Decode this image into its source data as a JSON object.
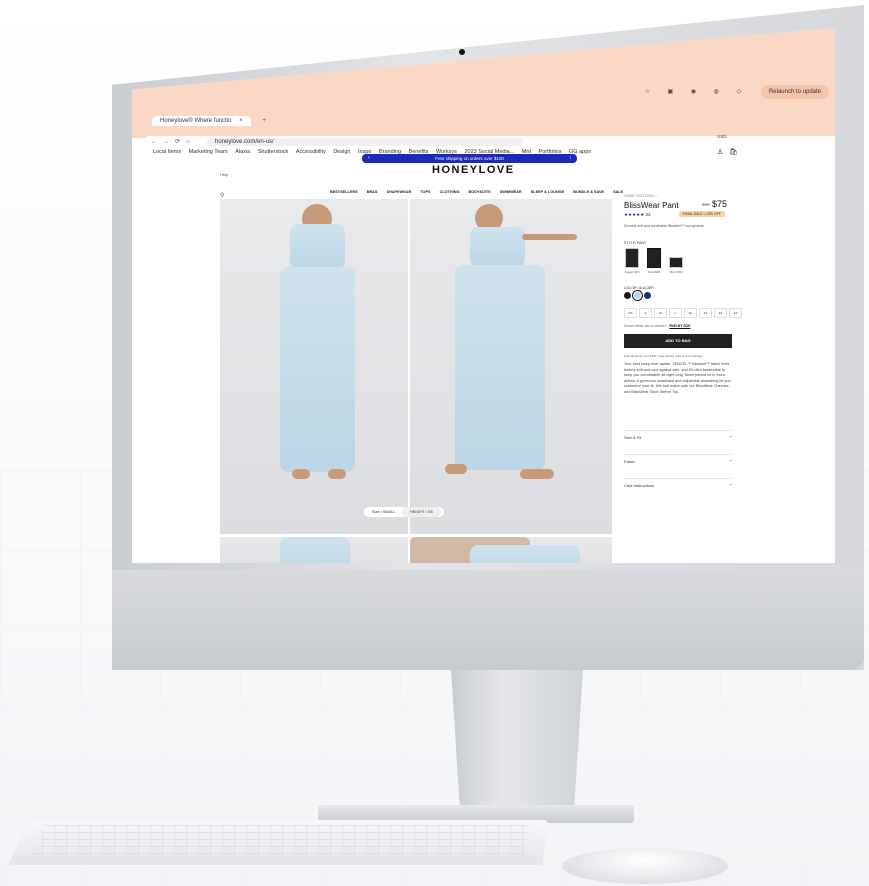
{
  "browser": {
    "tab_title": "Honeylove® Where functio",
    "new_tab": "+",
    "url": "honeylove.com/en-us/",
    "relaunch_label": "Relaunch to update",
    "bookmarks": [
      "Local Items",
      "Marketing Team",
      "Alaxia",
      "Shutterstock",
      "Accessibility",
      "Design",
      "Inspo",
      "Branding",
      "Benefits",
      "Worksys",
      "2023 Social Media...",
      "Mnt",
      "Portfolios",
      "GG apps"
    ]
  },
  "page": {
    "promo": "Free shipping on orders over $100",
    "help": "Help",
    "logo": "HONEYLOVE",
    "currency": "USD",
    "nav": [
      "BESTSELLERS",
      "BRAS",
      "SHAPEWEAR",
      "TOPS",
      "CLOTHING",
      "BODYSUITS",
      "SWIMWEAR",
      "SLEEP & LOUNGE",
      "BUNDLE & SAVE",
      "SALE"
    ],
    "image_pill": {
      "size": "Size • SMALL",
      "height": "HEIGHT • 5'8"
    }
  },
  "product": {
    "breadcrumb": "HOME / BOTTOMS /",
    "title": "BlissWear Pant",
    "old_price": "$88",
    "price": "$75",
    "rating": "★★★★★",
    "reviews": "32",
    "sale_badge": "FINAL SALE • 15% OFF",
    "short_desc": "Divinely soft and breathable Blissknit™ loungewear.",
    "style_label": "STYLE: PANT",
    "styles": [
      {
        "label": "Jogger $84"
      },
      {
        "label": "Pant $88"
      },
      {
        "label": "Short $64"
      }
    ],
    "color_label": "COLOR: GLACIER",
    "colors": [
      "#1a1a1a",
      "#b9d7e6",
      "#1f2f6e"
    ],
    "sizes": [
      "XS",
      "S",
      "M",
      "L",
      "XL",
      "2X",
      "3X",
      "4X"
    ],
    "fit_question": "Unsure which size to choose?",
    "fit_link": "FIND MY SIZE",
    "add_to_bag": "ADD TO BAG",
    "shipping_note": "Free shipping over $100. Free 30-day returns & exchanges.",
    "long_desc": "Your best sleep ever awaits. TENCEL™ Blissknit™ fabric feels buttery soft and cool against skin, and it's ultra breathable to keep you comfortable all night long. Mesh panels let in extra airflow. A generous waistband and adjustable drawstring let you customize your fit. Mix and match with our BlissWear Chemise and BlissWear Short Sleeve Top.",
    "accordions": [
      "Size & Fit",
      "Fabric",
      "Care Instructions"
    ]
  }
}
